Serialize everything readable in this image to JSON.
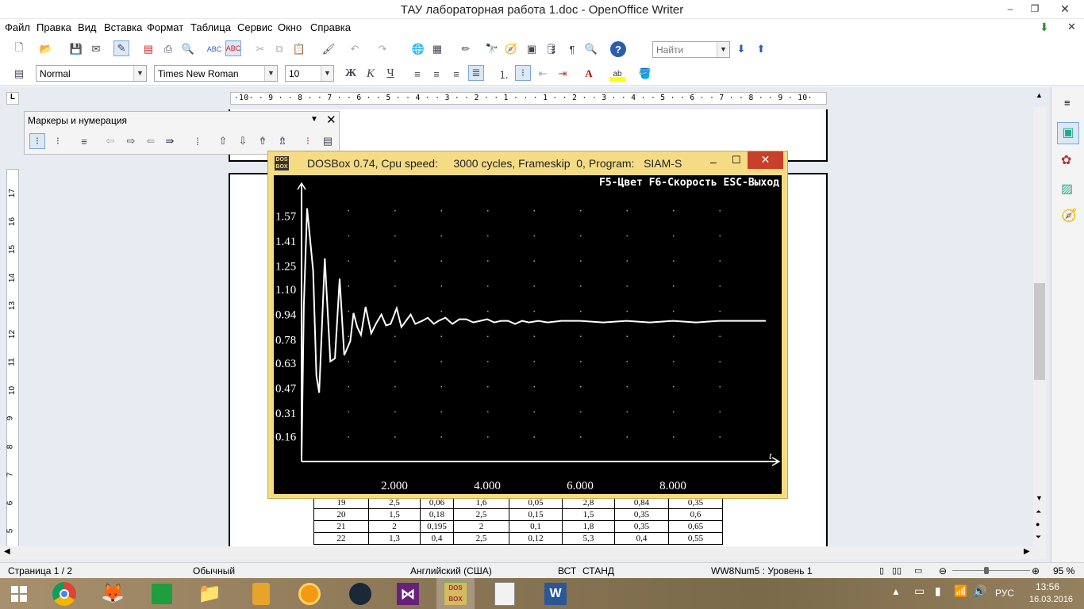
{
  "window": {
    "title": "ТАУ лабораторная работа 1.doc - OpenOffice Writer",
    "minimize": "–",
    "maximize": "❐",
    "close": "✕"
  },
  "menu": [
    "Файл",
    "Правка",
    "Вид",
    "Вставка",
    "Формат",
    "Таблица",
    "Сервис",
    "Окно",
    "Справка"
  ],
  "toolbar": {
    "find_placeholder": "Найти"
  },
  "format_toolbar": {
    "style": "Normal",
    "font": "Times New Roman",
    "size": "10",
    "bold": "Ж",
    "italic": "К",
    "underline": "Ч"
  },
  "hruler": "·10· · 9 · · 8 · · 7 · · 6 · · 5 · · 4 · · 3 · · 2 · · 1 · · · 1 · · 2 · · 3 · · 4 · · 5 · · 6 · · 7 · · 8 · · 9 · 10·",
  "vruler": [
    "17",
    "16",
    "15",
    "14",
    "13",
    "12",
    "11",
    "10",
    "9",
    "8",
    "7",
    "6",
    "5"
  ],
  "bullet_panel": {
    "title": "Маркеры и нумерация"
  },
  "dosbox": {
    "title": "DOSBox 0.74, Cpu speed:     3000 cycles, Frameskip  0, Program:   SIAM-S",
    "header_text": "F5-Цвет F6-Скорость ESC-Выход",
    "axis_label": "t"
  },
  "chart_data": {
    "type": "line",
    "title": "",
    "xlabel": "t",
    "ylabel": "",
    "xlim": [
      0,
      10.0
    ],
    "ylim": [
      0,
      1.73
    ],
    "y_ticks": [
      "1.57",
      "1.41",
      "1.25",
      "1.10",
      "0.94",
      "0.78",
      "0.63",
      "0.47",
      "0.31",
      "0.16"
    ],
    "y_tick_values": [
      1.57,
      1.41,
      1.25,
      1.1,
      0.94,
      0.78,
      0.63,
      0.47,
      0.31,
      0.16
    ],
    "x_ticks": [
      "2.000",
      "4.000",
      "6.000",
      "8.000"
    ],
    "x_tick_values": [
      2,
      4,
      6,
      8
    ],
    "series": [
      {
        "name": "",
        "x": [
          0,
          0.05,
          0.12,
          0.25,
          0.32,
          0.38,
          0.5,
          0.62,
          0.72,
          0.82,
          0.92,
          1.05,
          1.12,
          1.2,
          1.28,
          1.38,
          1.5,
          1.6,
          1.72,
          1.82,
          1.92,
          2.05,
          2.15,
          2.25,
          2.35,
          2.45,
          2.6,
          2.72,
          2.85,
          2.95,
          3.1,
          3.25,
          3.4,
          3.55,
          3.7,
          3.85,
          4.0,
          4.15,
          4.3,
          4.45,
          4.6,
          4.75,
          4.9,
          5.1,
          5.3,
          5.6,
          6.0,
          6.5,
          7.0,
          7.5,
          8.0,
          8.5,
          9.0,
          9.5,
          10.0
        ],
        "y": [
          0.02,
          1.0,
          1.62,
          1.22,
          0.55,
          0.44,
          1.3,
          0.64,
          0.66,
          1.17,
          0.68,
          0.77,
          0.95,
          0.86,
          0.81,
          0.99,
          0.82,
          0.88,
          0.94,
          0.87,
          0.88,
          0.98,
          0.86,
          0.9,
          0.94,
          0.88,
          0.9,
          0.92,
          0.88,
          0.9,
          0.92,
          0.88,
          0.91,
          0.91,
          0.89,
          0.9,
          0.91,
          0.89,
          0.9,
          0.9,
          0.88,
          0.9,
          0.89,
          0.9,
          0.89,
          0.9,
          0.9,
          0.89,
          0.9,
          0.89,
          0.9,
          0.89,
          0.9,
          0.9,
          0.9
        ]
      }
    ]
  },
  "table_rows": [
    [
      "19",
      "2,5",
      "0,06",
      "1,6",
      "0,05",
      "2,8",
      "0,84",
      "0,35"
    ],
    [
      "20",
      "1,5",
      "0,18",
      "2,5",
      "0,15",
      "1,5",
      "0,35",
      "0,6"
    ],
    [
      "21",
      "2",
      "0,195",
      "2",
      "0,1",
      "1,8",
      "0,35",
      "0,65"
    ],
    [
      "22",
      "1,3",
      "0,4",
      "2,5",
      "0,12",
      "5,3",
      "0,4",
      "0,55"
    ]
  ],
  "status": {
    "page": "Страница  1 / 2",
    "style": "Обычный",
    "language": "Английский (США)",
    "insert": "ВСТ",
    "select": "СТАНД",
    "list": "WW8Num5 : Уровень  1",
    "zoom": "95 %"
  },
  "tray": {
    "lang": "РУС",
    "time": "13:56",
    "date": "16.03.2016"
  }
}
